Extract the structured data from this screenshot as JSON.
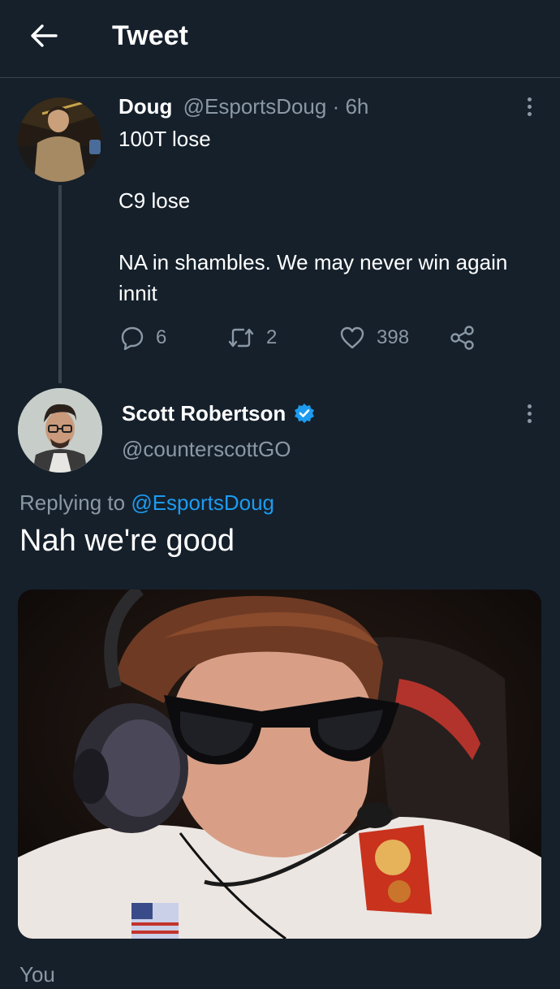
{
  "header": {
    "title": "Tweet"
  },
  "original_tweet": {
    "author_name": "Doug",
    "author_handle": "@EsportsDoug",
    "separator": " · ",
    "timestamp": "6h",
    "lines": [
      "100T lose",
      "C9 lose",
      "NA in shambles. We may never win again innit"
    ],
    "replies": "6",
    "retweets": "2",
    "likes": "398"
  },
  "reply_tweet": {
    "author_name": "Scott Robertson",
    "author_handle": "@counterscottGO",
    "replying_prefix": "Replying to ",
    "replying_handle": "@EsportsDoug",
    "text": "Nah we're good"
  },
  "footer_partial_text": "You",
  "colors": {
    "background": "#15202b",
    "text_primary": "#ffffff",
    "text_secondary": "#8b98a5",
    "accent": "#1d9bf0",
    "divider": "#38444d"
  }
}
